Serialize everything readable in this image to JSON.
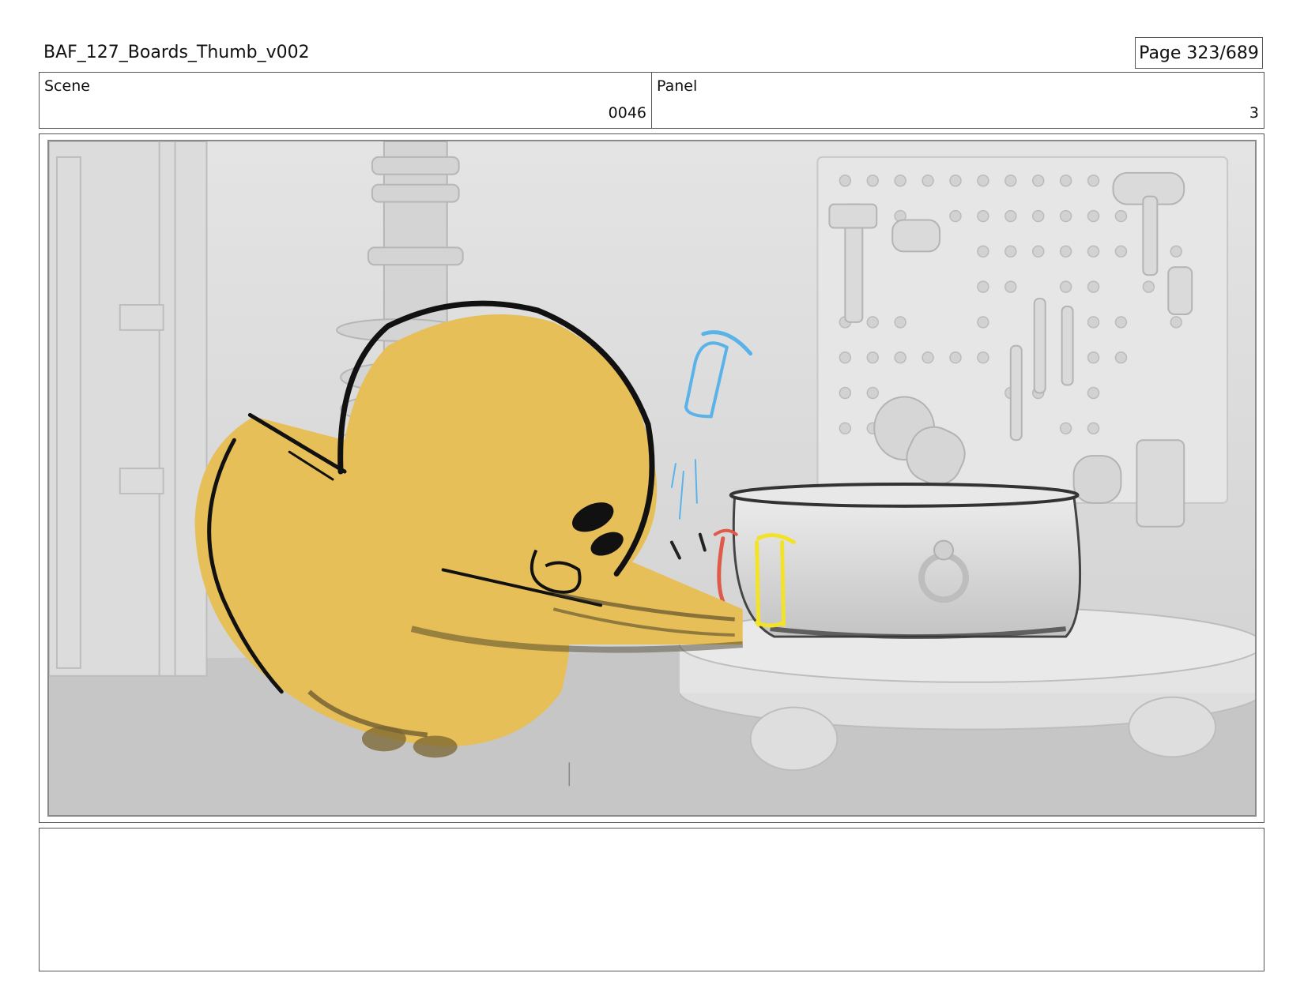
{
  "header": {
    "document_title": "BAF_127_Boards_Thumb_v002",
    "page_label": "Page 323/689"
  },
  "info": {
    "scene_label": "Scene",
    "scene_value": "0046",
    "panel_label": "Panel",
    "panel_value": "3"
  },
  "notes": {
    "text": ""
  },
  "colors": {
    "character_fill": "#e6bf58",
    "sketch_blue": "#5ab3e8",
    "sketch_red": "#e05a4a",
    "sketch_yellow": "#f2e22a",
    "background_gray": "#d9d9d9"
  }
}
